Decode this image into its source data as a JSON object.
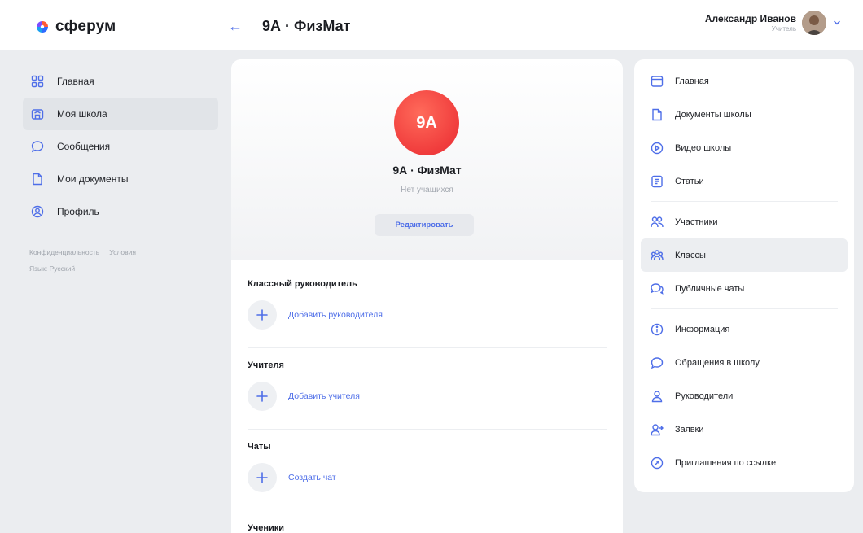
{
  "brand": {
    "name": "сферум"
  },
  "header": {
    "back_label": "←",
    "title": "9А · ФизМат"
  },
  "user": {
    "name": "Александр Иванов",
    "role": "Учитель"
  },
  "left_nav": {
    "items": [
      {
        "label": "Главная",
        "icon": "grid-icon"
      },
      {
        "label": "Моя школа",
        "icon": "school-icon",
        "active": true
      },
      {
        "label": "Сообщения",
        "icon": "chat-bubble-icon"
      },
      {
        "label": "Мои документы",
        "icon": "document-icon"
      },
      {
        "label": "Профиль",
        "icon": "profile-icon"
      }
    ],
    "footer_links": [
      "Конфиденциальность",
      "Условия"
    ],
    "language": "Язык: Русский"
  },
  "class_card": {
    "badge": "9А",
    "name": "9А · ФизМат",
    "subtitle": "Нет учащихся",
    "edit_label": "Редактировать",
    "sections": [
      {
        "title": "Классный руководитель",
        "action": "Добавить руководителя"
      },
      {
        "title": "Учителя",
        "action": "Добавить учителя"
      },
      {
        "title": "Чаты",
        "action": "Создать чат"
      },
      {
        "title": "Ученики"
      }
    ]
  },
  "right_nav": {
    "groups": [
      [
        {
          "label": "Главная",
          "icon": "browser-window-icon"
        },
        {
          "label": "Документы школы",
          "icon": "document-icon"
        },
        {
          "label": "Видео школы",
          "icon": "play-circle-icon"
        },
        {
          "label": "Статьи",
          "icon": "article-icon"
        }
      ],
      [
        {
          "label": "Участники",
          "icon": "people-icon"
        },
        {
          "label": "Классы",
          "icon": "group-icon",
          "active": true
        },
        {
          "label": "Публичные чаты",
          "icon": "chats-icon"
        }
      ],
      [
        {
          "label": "Информация",
          "icon": "info-icon"
        },
        {
          "label": "Обращения в школу",
          "icon": "chat-bubble-icon"
        },
        {
          "label": "Руководители",
          "icon": "person-icon"
        },
        {
          "label": "Заявки",
          "icon": "person-add-icon"
        },
        {
          "label": "Приглашения по ссылке",
          "icon": "link-arrow-icon"
        }
      ]
    ]
  },
  "colors": {
    "accent": "#4e6ee8",
    "badge": "#f03c3c",
    "background": "#ebedf0"
  }
}
